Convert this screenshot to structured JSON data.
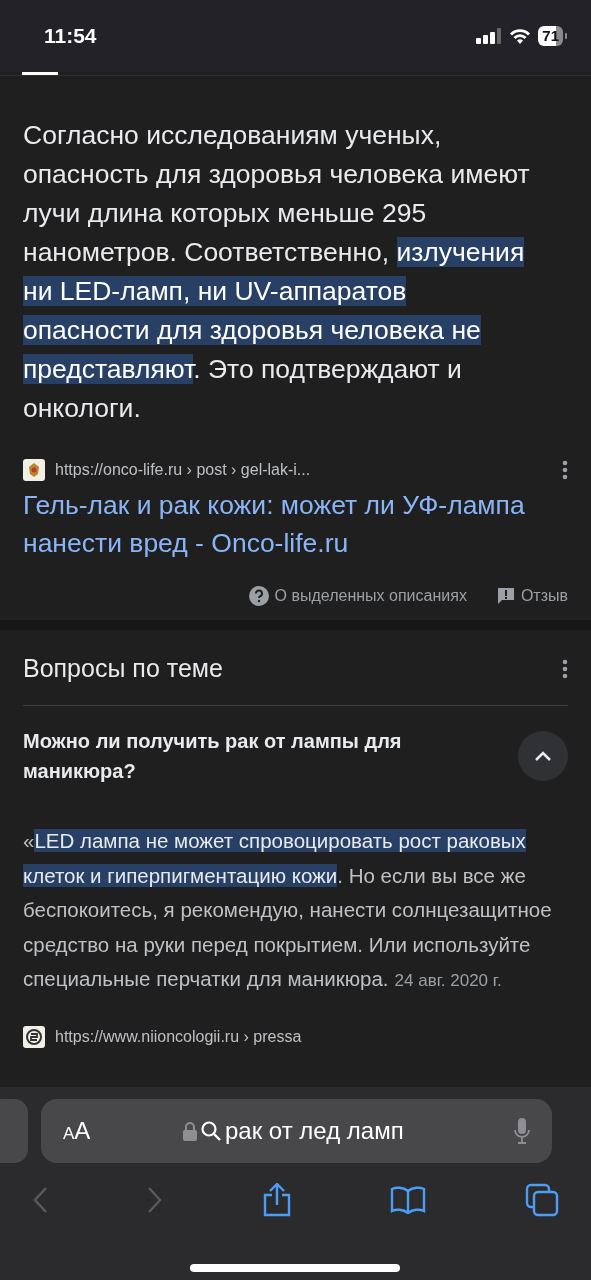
{
  "status_bar": {
    "time": "11:54",
    "battery": "71"
  },
  "snippet": {
    "segments": [
      {
        "text": "Согласно исследованиям ученых, опасность для здоровья человека имеют лучи длина которых меньше 295 нанометров. Соответственно, ",
        "highlighted": false
      },
      {
        "text": "излучения ни LED-ламп, ни UV-аппаратов опасности для здоровья человека не представляют",
        "highlighted": true
      },
      {
        "text": ". Это подтверждают и онкологи.",
        "highlighted": false
      }
    ],
    "url": "https://onco-life.ru › post › gel-lak-i...",
    "title": "Гель-лак и рак кожи: может ли УФ-лампа нанести вред - Onco-life.ru",
    "about_label": "О выделенных описаниях",
    "feedback_label": "Отзыв"
  },
  "related": {
    "heading": "Вопросы по теме",
    "questions": [
      {
        "question": "Можно ли получить рак от лампы для маникюра?",
        "expanded": true,
        "answer": [
          {
            "text": "«",
            "highlighted": false
          },
          {
            "text": "LED лампа не может спровоцировать рост раковых клеток и гиперпигментацию кожи",
            "highlighted": true
          },
          {
            "text": ". Но если вы все же беспокоитесь, я рекомендую, нанести солнцезащитное средство на руки перед покрытием. Или используйте специальные перчатки для маникюра.",
            "highlighted": false
          }
        ],
        "date": "24 авг. 2020 г.",
        "url": "https://www.niioncologii.ru › pressa"
      }
    ]
  },
  "toolbar": {
    "text_size_label": "AA",
    "query": "рак от лед ламп",
    "back_disabled": true,
    "forward_disabled": true
  }
}
